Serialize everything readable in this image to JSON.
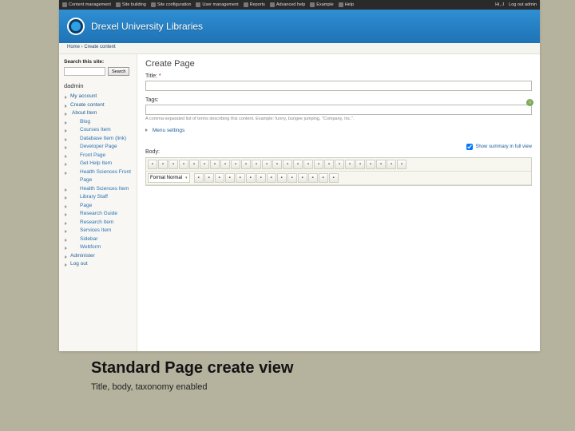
{
  "adminbar": {
    "left": [
      "Content management",
      "Site building",
      "Site configuration",
      "User management",
      "Reports",
      "Advanced help",
      "Example",
      "Help"
    ],
    "right": [
      "Hi, J",
      "Log out admin"
    ]
  },
  "header": {
    "sitename": "Drexel University Libraries"
  },
  "breadcrumb": "Home › Create content",
  "sidebar": {
    "search_label": "Search this site:",
    "search_button": "Search",
    "username": "dadmin",
    "nav": [
      {
        "label": "My account",
        "level": 1
      },
      {
        "label": "Create content",
        "level": 1
      },
      {
        "label": "About Item",
        "level": 2
      },
      {
        "label": "Blog",
        "level": 3
      },
      {
        "label": "Courses Item",
        "level": 3
      },
      {
        "label": "Database Item (link)",
        "level": 3
      },
      {
        "label": "Developer Page",
        "level": 3
      },
      {
        "label": "Front Page",
        "level": 3
      },
      {
        "label": "Get Help Item",
        "level": 3
      },
      {
        "label": "Health Sciences Front Page",
        "level": 3
      },
      {
        "label": "Health Sciences Item",
        "level": 3
      },
      {
        "label": "Library Staff",
        "level": 3
      },
      {
        "label": "Page",
        "level": 3,
        "current": true
      },
      {
        "label": "Research Guide",
        "level": 3
      },
      {
        "label": "Research Item",
        "level": 3
      },
      {
        "label": "Services Item",
        "level": 3
      },
      {
        "label": "Sidebar",
        "level": 3
      },
      {
        "label": "Webform",
        "level": 3
      },
      {
        "label": "Administer",
        "level": 1
      },
      {
        "label": "Log out",
        "level": 1
      }
    ]
  },
  "main": {
    "title": "Create Page",
    "title_label": "Title:",
    "tags_label": "Tags:",
    "tags_help": "A comma-separated list of terms describing this content. Example: funny, bungee jumping, \"Company, Inc.\".",
    "menu_settings": "Menu settings",
    "show_summary": "Show summary in full view",
    "body_label": "Body:",
    "editor_format": "Format Normal",
    "toolbar_icons_row1": [
      "source-icon",
      "cut-icon",
      "copy-icon",
      "paste-icon",
      "paste-text-icon",
      "paste-word-icon",
      "print-icon",
      "spellcheck-icon",
      "undo-icon",
      "redo-icon",
      "find-icon",
      "replace-icon",
      "select-all-icon",
      "remove-format-icon",
      "image-icon",
      "flash-icon",
      "table-icon",
      "hr-icon",
      "smiley-icon",
      "special-char-icon",
      "page-break-icon",
      "link-icon",
      "unlink-icon",
      "anchor-icon",
      "maximize-icon"
    ],
    "toolbar_icons_row2": [
      "bold-icon",
      "italic-icon",
      "underline-icon",
      "ol-icon",
      "ul-icon",
      "outdent-icon",
      "indent-icon",
      "align-left-icon",
      "align-center-icon",
      "align-right-icon",
      "align-justify-icon",
      "textcolor-icon",
      "bgcolor-icon",
      "teaser-icon"
    ]
  },
  "caption": {
    "heading": "Standard Page create view",
    "sub": "Title, body, taxonomy enabled"
  }
}
